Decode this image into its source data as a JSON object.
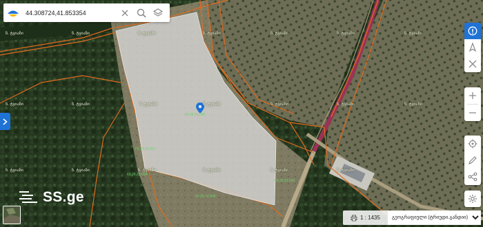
{
  "search": {
    "value": "44.308724,41.853354"
  },
  "map": {
    "parcel_label": "ნ. ტყიანი",
    "parcel_labels": [
      "ნ. ტყიანი",
      "ნ. ტყიანი",
      "ნ. ტყიანი",
      "ნ. ტყიანი",
      "ნ. ტყიანი",
      "ნ. ტყიანი",
      "ნ. ტყიანი",
      "ნ. ტყიანი",
      "ნ. ტყიანი",
      "ნ. ტყიანი",
      "ნ. ტყიანი",
      "ნ. ტყიანი",
      "ნ. ტყიანი",
      "ნ. ტყიანი",
      "ნ. ტყიანი",
      "ნ. ტყიანი",
      "ნ. ტყიანი",
      "ნ. ტყიანი",
      "ნ. ტყიანი",
      "ნ. ტყიანი"
    ],
    "cadastral_codes": [
      "69.29.23.017",
      "69.29.23.068",
      "69.29.23.040",
      "69.29.23.008",
      "69.29.23.016"
    ],
    "colors": {
      "parcel_border": "#e06b1e",
      "road": "#9b3354",
      "selected_fill": "#d7d7d7",
      "accent": "#1f73d6"
    }
  },
  "brand": {
    "text": "SS.ge"
  },
  "footer": {
    "scale": "1 : 1435",
    "layer": "გეოგრაფიული (ტრიუდი.განდიი)"
  },
  "icons": {
    "logo": "ssge-map-logo-icon",
    "clear": "close-icon",
    "search": "search-icon",
    "layers": "layers-icon",
    "panel_toggle": "chevron-right-icon",
    "info": "info-icon",
    "navigate": "compass-icon",
    "measure": "ruler-icon",
    "zoom_in": "plus-icon",
    "zoom_out": "minus-icon",
    "locate": "crosshair-icon",
    "draw": "pencil-icon",
    "share": "share-icon",
    "settings": "gear-icon",
    "print": "printer-icon",
    "marker": "map-pin-icon"
  }
}
